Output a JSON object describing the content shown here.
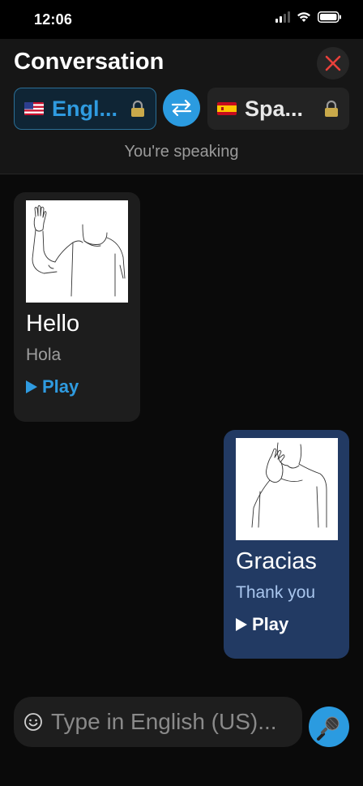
{
  "status_bar": {
    "time": "12:06"
  },
  "header": {
    "title": "Conversation",
    "source_language": {
      "label": "Engl...",
      "flag": "us-flag-icon",
      "locked": true
    },
    "target_language": {
      "label": "Spa...",
      "flag": "es-flag-icon",
      "locked": true
    },
    "speaking_label": "You're speaking"
  },
  "messages": [
    {
      "side": "left",
      "text": "Hello",
      "translation": "Hola",
      "play_label": "Play"
    },
    {
      "side": "right",
      "text": "Gracias",
      "translation": "Thank you",
      "play_label": "Play"
    }
  ],
  "composer": {
    "placeholder": "Type in English (US)..."
  },
  "colors": {
    "accent": "#2b9be0",
    "close": "#e8403a",
    "bubble_right": "#223a63",
    "bubble_left": "#1d1d1d"
  }
}
